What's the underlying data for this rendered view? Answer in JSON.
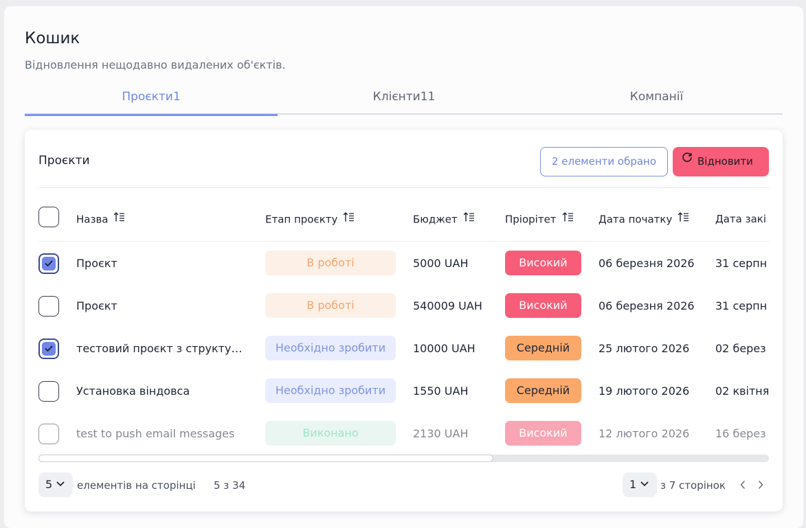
{
  "page": {
    "title": "Кошик",
    "subtitle": "Відновлення нещодавно видалених об'єктів."
  },
  "tabs": [
    {
      "label": "Проєкти1",
      "active": true
    },
    {
      "label": "Клієнти11",
      "active": false
    },
    {
      "label": "Компанії",
      "active": false
    }
  ],
  "card": {
    "title": "Проєкти",
    "selected_label": "2 елементи обрано",
    "restore_label": "Відновити"
  },
  "table": {
    "headers": [
      "Назва",
      "Етап проєкту",
      "Бюджет",
      "Пріорітет",
      "Дата початку",
      "Дата закі"
    ],
    "rows": [
      {
        "checked": true,
        "name": "Проєкт",
        "stage": "В роботі",
        "budget": "5000 UAH",
        "priority": "Високий",
        "start": "06 березня 2026",
        "end": "31 серпн"
      },
      {
        "checked": false,
        "name": "Проєкт",
        "stage": "В роботі",
        "budget": "540009 UAH",
        "priority": "Високий",
        "start": "06 березня 2026",
        "end": "31 серпн"
      },
      {
        "checked": true,
        "name": "тестовий проєкт з структур...",
        "stage": "Необхідно зробити",
        "budget": "10000 UAH",
        "priority": "Середній",
        "start": "25 лютого 2026",
        "end": "02 берез"
      },
      {
        "checked": false,
        "name": "Установка віндовса",
        "stage": "Необхідно зробити",
        "budget": "1550 UAH",
        "priority": "Середній",
        "start": "19 лютого 2026",
        "end": "02 квітня"
      },
      {
        "checked": false,
        "name": "test to push email messages",
        "stage": "Виконано",
        "budget": "2130 UAH",
        "priority": "Високий",
        "start": "12 лютого 2026",
        "end": "16 берез"
      }
    ]
  },
  "footer": {
    "per_page_value": "5",
    "per_page_label": "елементів на сторінці",
    "range_text": "5 з 34",
    "page_value": "1",
    "pages_text": "з 7 сторінок"
  },
  "colors": {
    "accent": "#7b93ea",
    "restore_button": "#f75d78",
    "stage_in_progress_bg": "#fdf0e6",
    "stage_in_progress_text": "#f3a56f",
    "stage_todo_bg": "#e9edfd",
    "stage_todo_text": "#7f93e3",
    "stage_done_bg": "#d9efe6",
    "stage_done_text": "#4fcf98",
    "priority_high": "#f75d78",
    "priority_medium": "#fba96b"
  }
}
